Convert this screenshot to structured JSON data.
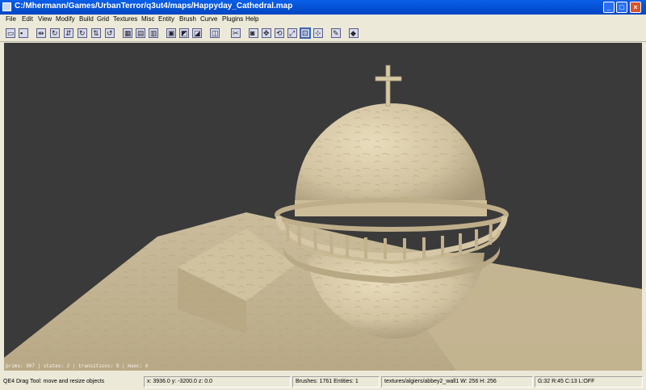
{
  "window": {
    "title": "C:/Mhermann/Games/UrbanTerror/q3ut4/maps/Happyday_Cathedral.map",
    "minimize_glyph": "_",
    "maximize_glyph": "□",
    "close_glyph": "×"
  },
  "menu": [
    "File",
    "Edit",
    "View",
    "Modify",
    "Build",
    "Grid",
    "Textures",
    "Misc",
    "Entity",
    "Brush",
    "Curve",
    "Plugins",
    "Help"
  ],
  "toolbar": {
    "tools": [
      {
        "name": "open-icon",
        "glyph": "▭"
      },
      {
        "name": "save-icon",
        "glyph": "▪"
      },
      {
        "name": "flip-x-icon",
        "glyph": "⇹"
      },
      {
        "name": "rotate-x-icon",
        "glyph": "↻"
      },
      {
        "name": "flip-y-icon",
        "glyph": "⇵"
      },
      {
        "name": "rotate-y-icon",
        "glyph": "↻"
      },
      {
        "name": "flip-z-icon",
        "glyph": "⇅"
      },
      {
        "name": "rotate-z-icon",
        "glyph": "↺"
      },
      {
        "name": "select-complete-tall-icon",
        "glyph": "▦"
      },
      {
        "name": "select-touching-icon",
        "glyph": "▤"
      },
      {
        "name": "select-partial-tall-icon",
        "glyph": "▥"
      },
      {
        "name": "select-inside-icon",
        "glyph": "▣"
      },
      {
        "name": "csg-subtract-icon",
        "glyph": "◩"
      },
      {
        "name": "csg-merge-icon",
        "glyph": "◪"
      },
      {
        "name": "make-hollow-icon",
        "glyph": "◫"
      },
      {
        "name": "clipper-icon",
        "glyph": "✂"
      },
      {
        "name": "camera-icon",
        "glyph": "◙"
      },
      {
        "name": "translate-icon",
        "glyph": "✥"
      },
      {
        "name": "rotate-icon",
        "glyph": "⟲"
      },
      {
        "name": "scale-icon",
        "glyph": "⤢"
      },
      {
        "name": "drag-tool-icon",
        "glyph": "⊡"
      },
      {
        "name": "patch-icon",
        "glyph": "⊹"
      },
      {
        "name": "texture-lock-icon",
        "glyph": "✎"
      },
      {
        "name": "entity-icon",
        "glyph": "◆"
      }
    ],
    "active": "drag-tool-icon"
  },
  "viewport": {
    "background": "#3a3a3a",
    "render_stats": "prims: 907 | states: 2 | transitions: 8 | msec: 6"
  },
  "status": {
    "message": "QE4 Drag Tool: move and resize objects",
    "coords": "x:  3936.0  y: -3200.0  z:    0.0",
    "counts": "Brushes: 1761 Entities: 1",
    "texture": "textures/algiers/abbey2_wall1 W: 256 H: 256",
    "grid": "G:32 R:45 C:13 L:OFF"
  },
  "colors": {
    "titlebar": "#0453d6",
    "stone": "#d2c3a1",
    "stone_shadow": "#a89a7a"
  }
}
